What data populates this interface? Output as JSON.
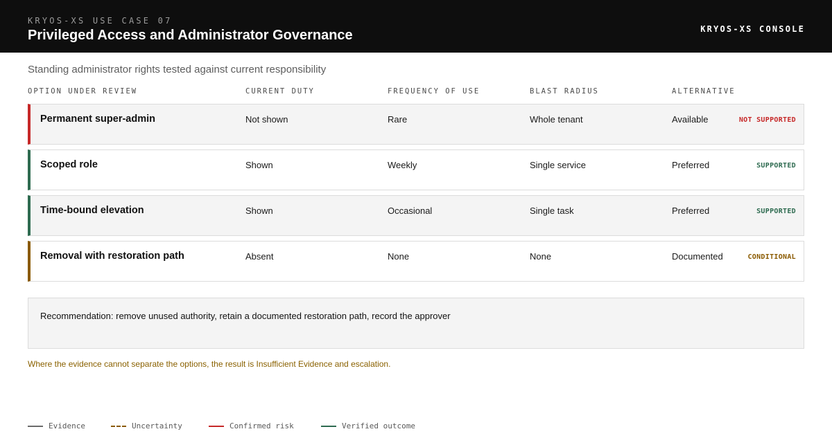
{
  "header": {
    "eyebrow": "KRYOS-XS USE CASE 07",
    "title": "Privileged Access and Administrator Governance",
    "console": "KRYOS-XS CONSOLE"
  },
  "subtitle": "Standing administrator rights tested against current responsibility",
  "table": {
    "columns": [
      "OPTION UNDER REVIEW",
      "CURRENT DUTY",
      "FREQUENCY OF USE",
      "BLAST RADIUS",
      "ALTERNATIVE"
    ],
    "rows": [
      {
        "option": "Permanent super-admin",
        "duty": "Not shown",
        "frequency": "Rare",
        "blast": "Whole tenant",
        "alternative": "Available",
        "status": "NOT SUPPORTED",
        "color": "#c62828"
      },
      {
        "option": "Scoped role",
        "duty": "Shown",
        "frequency": "Weekly",
        "blast": "Single service",
        "alternative": "Preferred",
        "status": "SUPPORTED",
        "color": "#2e6b50"
      },
      {
        "option": "Time-bound elevation",
        "duty": "Shown",
        "frequency": "Occasional",
        "blast": "Single task",
        "alternative": "Preferred",
        "status": "SUPPORTED",
        "color": "#2e6b50"
      },
      {
        "option": "Removal with restoration path",
        "duty": "Absent",
        "frequency": "None",
        "blast": "None",
        "alternative": "Documented",
        "status": "CONDITIONAL",
        "color": "#8a5a00"
      }
    ]
  },
  "recommendation": "Recommendation: remove unused authority, retain a documented restoration path, record the approver",
  "note": "Where the evidence cannot separate the options, the result is Insufficient Evidence and escalation.",
  "legend": [
    {
      "label": "Evidence",
      "color": "#6b6b6b",
      "style": "solid"
    },
    {
      "label": "Uncertainty",
      "color": "#8a5a00",
      "style": "dashed"
    },
    {
      "label": "Confirmed risk",
      "color": "#c62828",
      "style": "solid"
    },
    {
      "label": "Verified outcome",
      "color": "#2e6b50",
      "style": "solid"
    }
  ]
}
